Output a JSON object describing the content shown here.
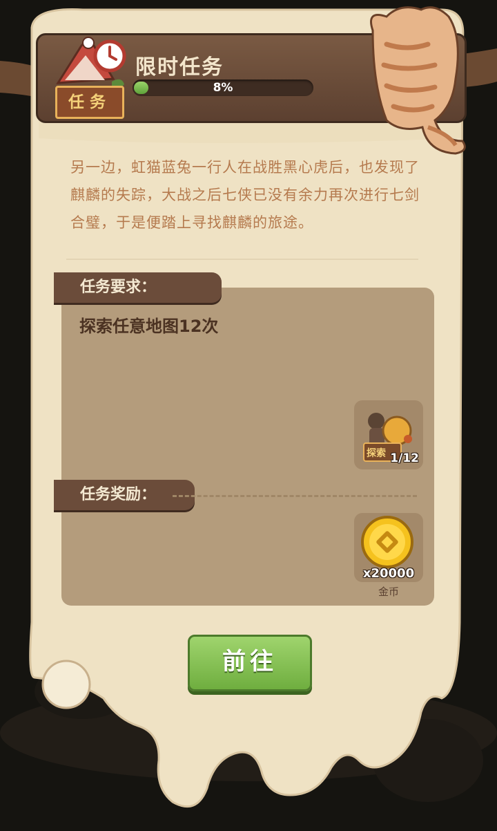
{
  "header": {
    "title": "限时任务",
    "badge_label": "任务",
    "progress_fraction": 0.08,
    "progress_text": "8%"
  },
  "story": {
    "text": "另一边，虹猫蓝兔一行人在战胜黑心虎后，也发现了麒麟的失踪，大战之后七侠已没有余力再次进行七剑合璧，于是便踏上寻找麒麟的旅途。"
  },
  "requirement": {
    "tag_label": "任务要求：",
    "text": "探索任意地图12次",
    "item": {
      "icon": "explore-icon",
      "label": "探索",
      "count": "1/12"
    }
  },
  "reward": {
    "tag_label": "任务奖励：",
    "item": {
      "icon": "gold-coin-icon",
      "amount": "x20000",
      "name": "金币"
    }
  },
  "action": {
    "go_label": "前往"
  },
  "colors": {
    "parchment": "#f0e3c6",
    "wood": "#6b4c3a",
    "progress_green": "#6fae3f",
    "button_green": "#8cc85a"
  }
}
